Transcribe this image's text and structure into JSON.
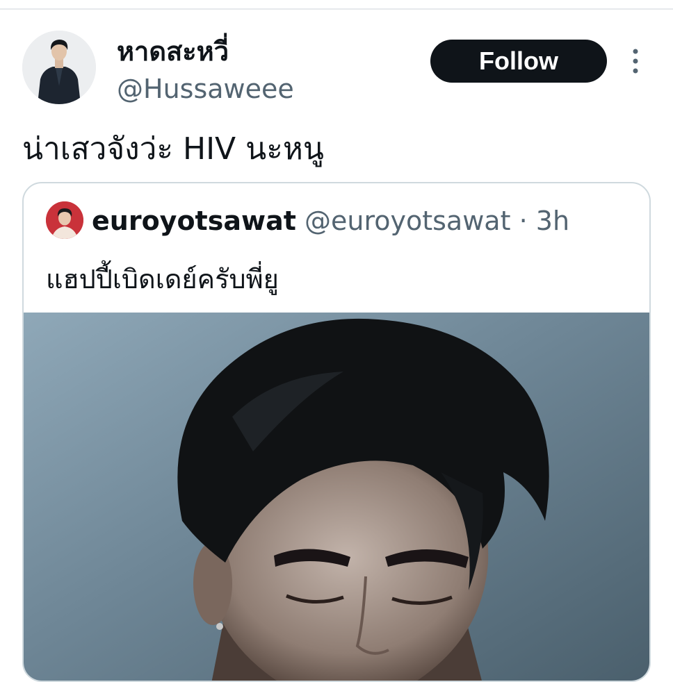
{
  "tweet": {
    "display_name": "หาดสะหวี่",
    "handle": "@Hussaweee",
    "follow_label": "Follow",
    "text": "น่าเสวจังว่ะ HIV นะหนู"
  },
  "quoted_tweet": {
    "display_name": "euroyotsawat",
    "handle": "@euroyotsawat",
    "separator": "·",
    "time": "3h",
    "text": "แฮปปี้เบิดเดย์ครับพี่ยู"
  },
  "icons": {
    "more": "more-vertical-icon"
  },
  "colors": {
    "follow_bg": "#0f1419",
    "follow_fg": "#ffffff",
    "secondary_text": "#536471",
    "card_border": "#cfd9de"
  }
}
